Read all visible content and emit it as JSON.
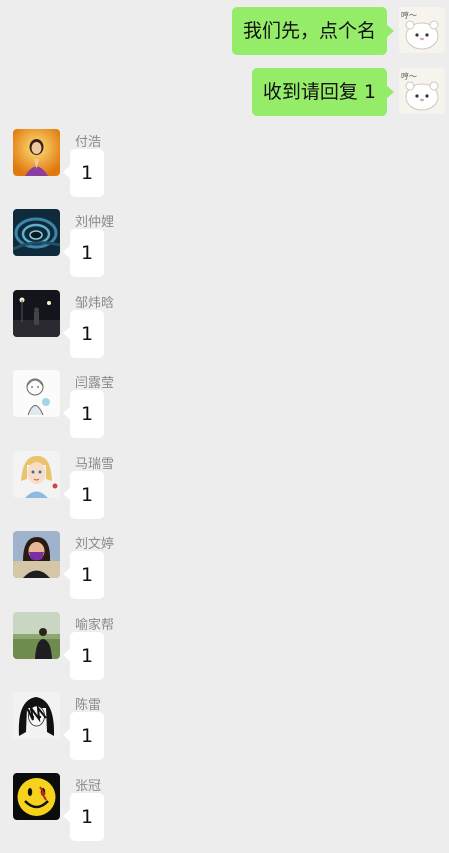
{
  "outgoing": [
    {
      "text": "我们先，点个名",
      "avatar_icon": "cartoon-bear-sticker-avatar",
      "sticker_text": "哼～"
    },
    {
      "text": "收到请回复 1",
      "avatar_icon": "cartoon-bear-sticker-avatar",
      "sticker_text": "哼～"
    }
  ],
  "incoming": [
    {
      "name": "付浩",
      "reply": "1",
      "avatar_icon": "woman-praying-photo-avatar"
    },
    {
      "name": "刘仲娌",
      "reply": "1",
      "avatar_icon": "blue-swirl-avatar"
    },
    {
      "name": "邹炜晗",
      "reply": "1",
      "avatar_icon": "night-street-avatar"
    },
    {
      "name": "闫露莹",
      "reply": "1",
      "avatar_icon": "sketch-girl-avatar"
    },
    {
      "name": "马瑞雪",
      "reply": "1",
      "avatar_icon": "anime-girl-avatar"
    },
    {
      "name": "刘文婷",
      "reply": "1",
      "avatar_icon": "masked-woman-avatar"
    },
    {
      "name": "喻家帮",
      "reply": "1",
      "avatar_icon": "man-in-field-avatar"
    },
    {
      "name": "陈雷",
      "reply": "1",
      "avatar_icon": "manga-character-avatar"
    },
    {
      "name": "张冠",
      "reply": "1",
      "avatar_icon": "smiley-face-avatar"
    }
  ],
  "colors": {
    "background": "#ededed",
    "outgoing_bubble": "#95ec69",
    "incoming_bubble": "#ffffff",
    "nickname": "#8a8a8a"
  }
}
